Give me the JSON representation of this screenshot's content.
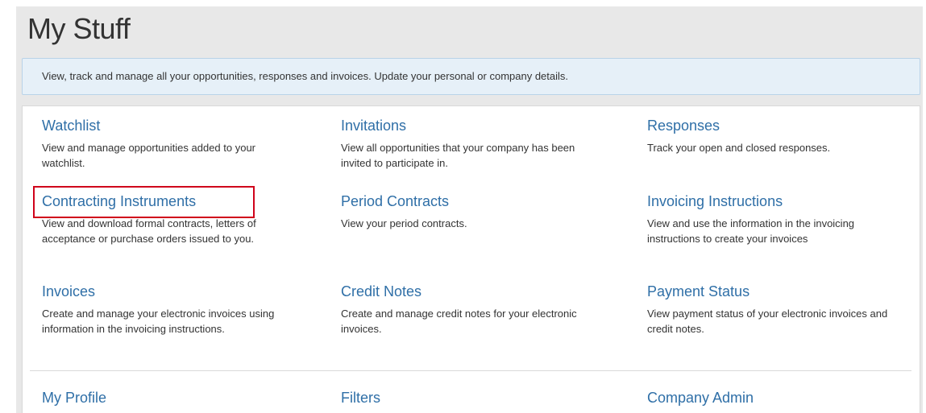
{
  "page": {
    "title": "My Stuff"
  },
  "banner": {
    "text": "View, track and manage all your opportunities, responses and invoices. Update your personal or company details."
  },
  "tiles": {
    "watchlist": {
      "label": "Watchlist",
      "description": "View and manage opportunities added to your watchlist."
    },
    "invitations": {
      "label": "Invitations",
      "description": "View all opportunities that your company has been invited to participate in."
    },
    "responses": {
      "label": "Responses",
      "description": "Track your open and closed responses."
    },
    "contracting_instruments": {
      "label": "Contracting Instruments",
      "description": "View and download formal contracts, letters of acceptance or purchase orders issued to you."
    },
    "period_contracts": {
      "label": "Period Contracts",
      "description": "View your period contracts."
    },
    "invoicing_instructions": {
      "label": "Invoicing Instructions",
      "description": "View and use the information in the invoicing instructions to create your invoices"
    },
    "invoices": {
      "label": "Invoices",
      "description": "Create and manage your electronic invoices using information in the invoicing instructions."
    },
    "credit_notes": {
      "label": "Credit Notes",
      "description": "Create and manage credit notes for your electronic invoices."
    },
    "payment_status": {
      "label": "Payment Status",
      "description": "View payment status of your electronic invoices and credit notes."
    },
    "my_profile": {
      "label": "My Profile"
    },
    "filters": {
      "label": "Filters"
    },
    "company_admin": {
      "label": "Company Admin"
    }
  },
  "colors": {
    "link": "#2f6fa7",
    "banner_background": "#e6f0f8",
    "highlight_border": "#d0021b",
    "panel_background": "#e8e8e8"
  }
}
